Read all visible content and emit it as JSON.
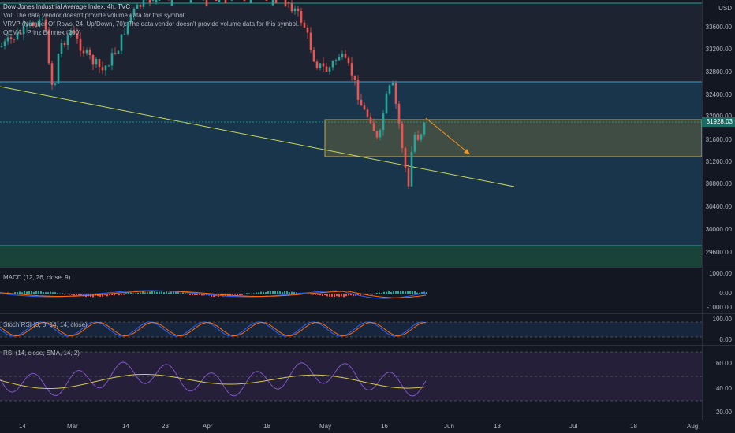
{
  "main_pane": {
    "title": "Dow Jones Industrial Average Index, 4h, TVC",
    "vol_legend": "Vol: The data vendor doesn't provide volume data for this symbol.",
    "vrvp_legend": "VRVP (Number Of Rows, 24, Up/Down, 70): The data vendor doesn't provide volume data for this symbol.",
    "qema_legend": "QEMA - Prinz Bennex (200)",
    "currency": "USD",
    "price_ticks": [
      "33600.00",
      "33200.00",
      "32800.00",
      "32400.00",
      "32000.00",
      "31600.00",
      "31200.00",
      "30800.00",
      "30400.00",
      "30000.00",
      "29600.00"
    ],
    "last_price": "31928.03"
  },
  "macd_pane": {
    "legend": "MACD (12, 26, close, 9)",
    "ticks": [
      "1000.00",
      "0.00",
      "-1000.00"
    ]
  },
  "stoch_pane": {
    "legend": "Stoch RSI (3, 3, 14, 14, close)",
    "ticks": [
      "100.00",
      "0.00"
    ]
  },
  "rsi_pane": {
    "legend": "RSI (14, close, SMA, 14, 2)",
    "ticks": [
      "60.00",
      "40.00",
      "20.00"
    ]
  },
  "time_axis": [
    "14",
    "Mar",
    "14",
    "23",
    "Apr",
    "18",
    "May",
    "16",
    "Jun",
    "13",
    "Jul",
    "18",
    "Aug"
  ],
  "colors": {
    "up": "#26a69a",
    "down": "#ef5350",
    "zone_blue": "#1e4e6e",
    "zone_green": "#1b4d3e",
    "trendline": "#c8d65a",
    "target_arrow": "#f7931a"
  }
}
